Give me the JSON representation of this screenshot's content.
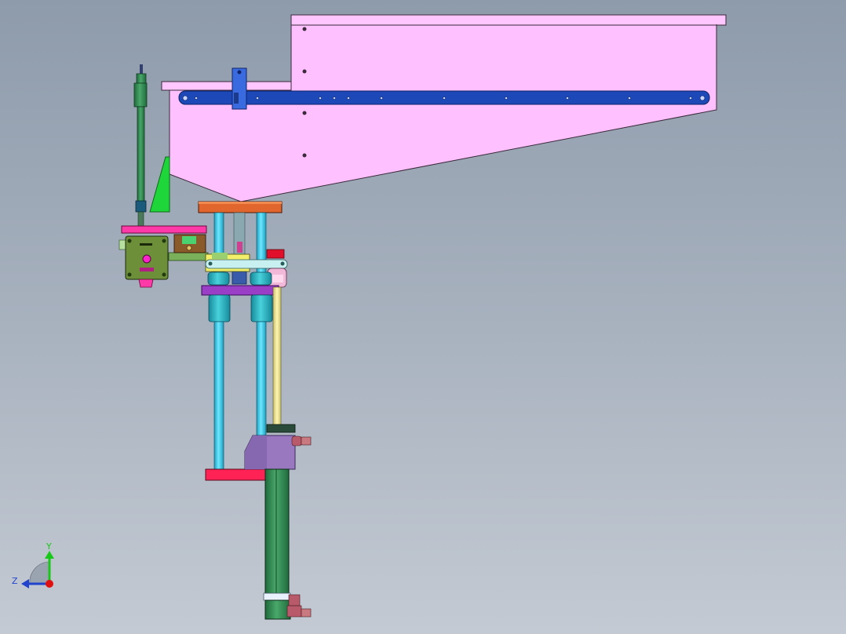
{
  "triad": {
    "y_label": "Y",
    "z_label": "Z"
  },
  "colors": {
    "background_top": "#8e9bab",
    "background_bottom": "#c4cad3",
    "hopper": "#ffc0ff",
    "rail": "#1c48b8",
    "column": "#33c8e6",
    "top_plate": "#e0662e",
    "guide_plate": "#9a3ec8",
    "bottom_plate": "#ff2255",
    "cylinder": "#2f8a52",
    "motor": "#6e8f3a",
    "bracket": "#ff3aa8",
    "gusset": "#1fd63a",
    "cylinder_block": "#9a78c0",
    "axis_y": "#18c818",
    "axis_z": "#2244cc",
    "axis_x": "#e01010"
  }
}
